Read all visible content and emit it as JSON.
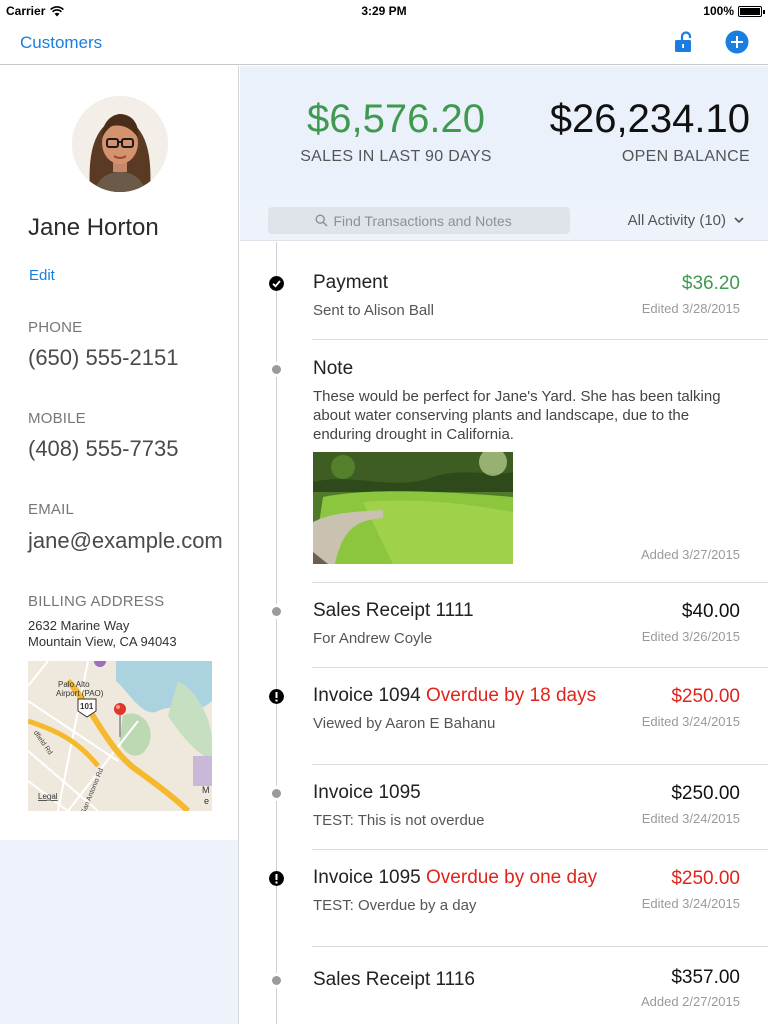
{
  "status_bar": {
    "carrier": "Carrier",
    "time": "3:29 PM",
    "battery": "100%"
  },
  "nav": {
    "back_label": "Customers",
    "icons": [
      "lock-open-icon",
      "add-circle-icon"
    ]
  },
  "customer": {
    "name": "Jane Horton",
    "edit_label": "Edit",
    "phone_label": "PHONE",
    "phone": "(650) 555-2151",
    "mobile_label": "MOBILE",
    "mobile": "(408) 555-7735",
    "email_label": "EMAIL",
    "email": "jane@example.com",
    "billing_label": "BILLING ADDRESS",
    "address_line1": "2632 Marine Way",
    "address_line2": "Mountain View, CA 94043",
    "map": {
      "label_airport": "Palo Alto",
      "label_airport2": "Airport (PAO)",
      "label_highway": "101",
      "label_legal": "Legal",
      "label_road1": "dfield Rd",
      "label_road2": "San Antonio Rd",
      "label_corner": "M",
      "label_corner2": "e"
    }
  },
  "summary": {
    "sales_amount": "$6,576.20",
    "sales_label": "SALES IN LAST 90 DAYS",
    "balance_amount": "$26,234.10",
    "balance_label": "OPEN BALANCE"
  },
  "filter": {
    "search_placeholder": "Find Transactions and Notes",
    "activity_label": "All Activity (10)"
  },
  "colors": {
    "accent": "#1a7ee0",
    "positive": "#3f9a50",
    "overdue": "#e0241c",
    "header_bg": "#eaf1fb"
  },
  "transactions": [
    {
      "title": "Payment",
      "status": "",
      "subtitle": "Sent to Alison Ball",
      "amount": "$36.20",
      "date": "Edited 3/28/2015",
      "icon": "check-circle-icon"
    },
    {
      "title": "Note",
      "body": "These would be perfect for Jane's Yard. She has been talking about water conserving plants and landscape, due to the enduring drought in California.",
      "date": "Added 3/27/2015",
      "icon": "dot-icon"
    },
    {
      "title": "Sales Receipt 1111",
      "status": "",
      "subtitle": "For Andrew Coyle",
      "amount": "$40.00",
      "date": "Edited 3/26/2015",
      "icon": "dot-icon"
    },
    {
      "title": "Invoice 1094",
      "status": "Overdue by 18 days",
      "subtitle": "Viewed by Aaron E Bahanu",
      "amount": "$250.00",
      "date": "Edited 3/24/2015",
      "icon": "alert-icon"
    },
    {
      "title": "Invoice 1095",
      "status": "",
      "subtitle": "TEST: This is not overdue",
      "amount": "$250.00",
      "date": "Edited 3/24/2015",
      "icon": "dot-icon"
    },
    {
      "title": "Invoice 1095",
      "status": "Overdue by one day",
      "subtitle": "TEST: Overdue by a day",
      "amount": "$250.00",
      "date": "Edited 3/24/2015",
      "icon": "alert-icon"
    },
    {
      "title": "Sales Receipt 1116",
      "status": "",
      "subtitle": "",
      "amount": "$357.00",
      "date": "Added 2/27/2015",
      "icon": "dot-icon"
    }
  ]
}
